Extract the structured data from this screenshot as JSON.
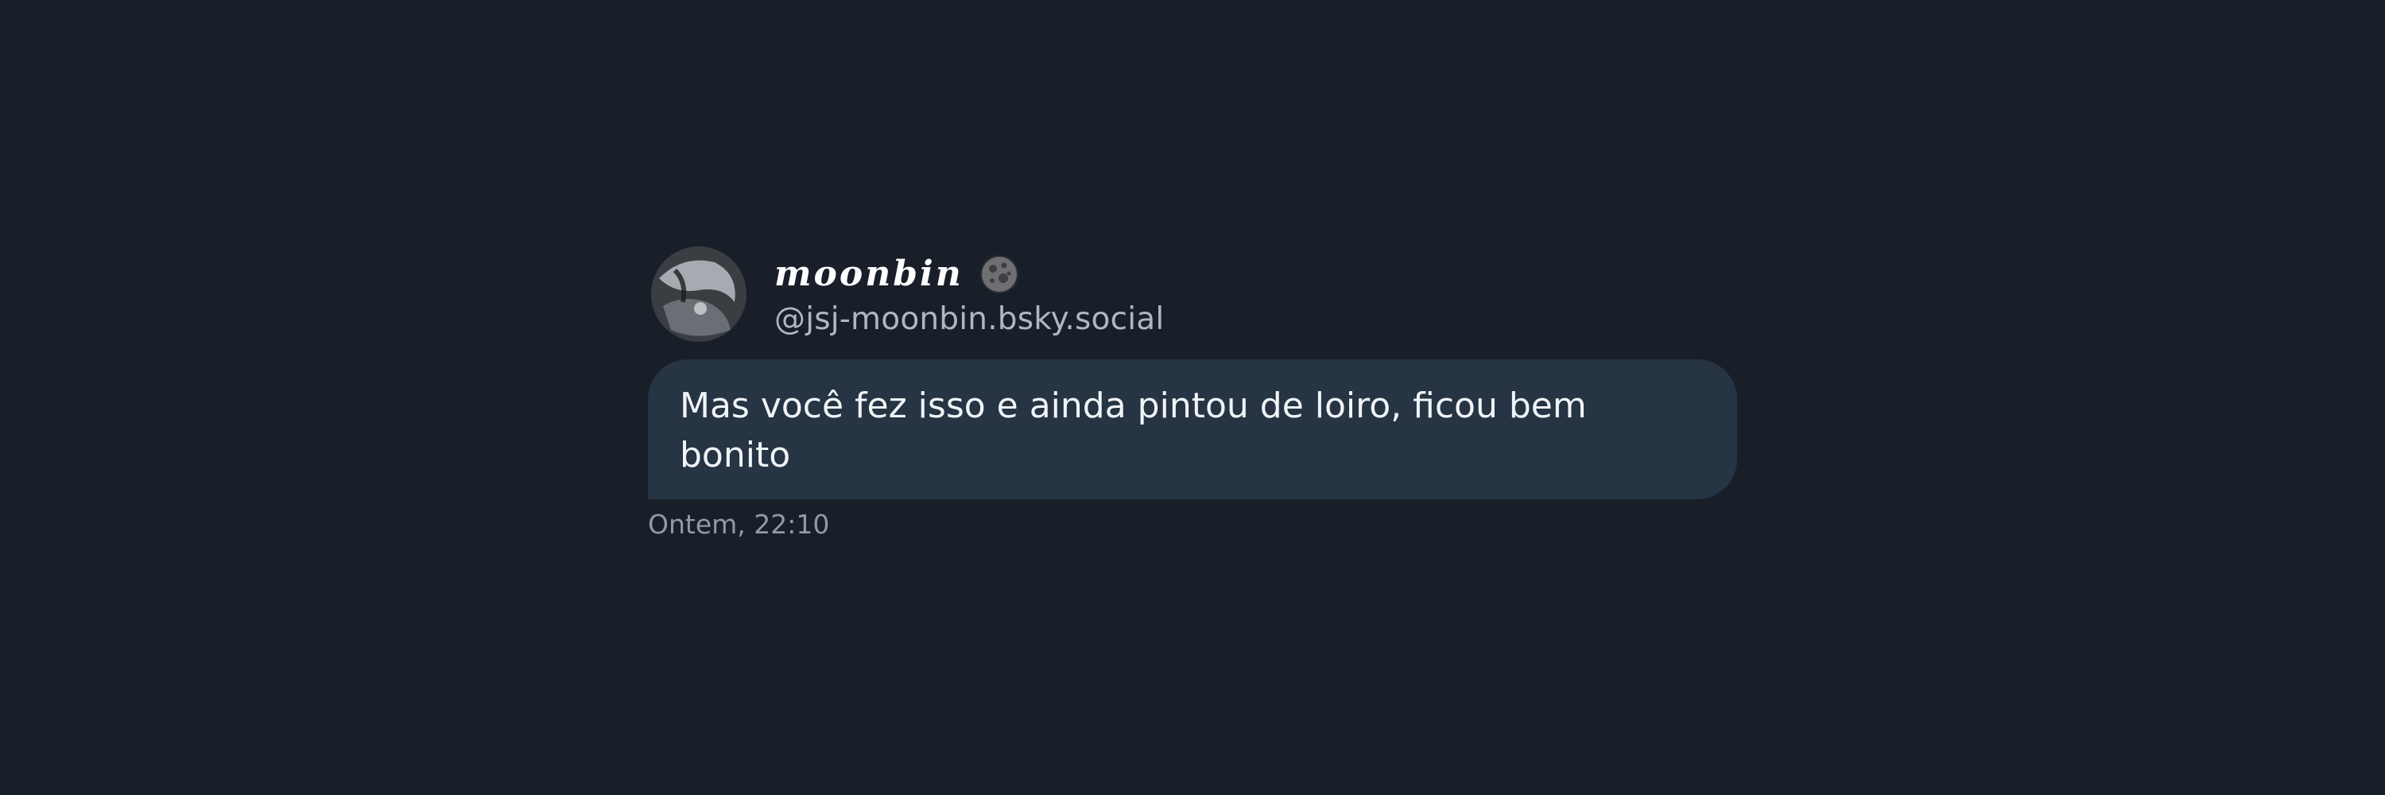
{
  "message": {
    "author": {
      "display_name": "moonbin",
      "handle": "@jsj-moonbin.bsky.social",
      "avatar_icon": "avatar-photo",
      "badge_icon": "moon-icon"
    },
    "text": "Mas você fez isso e ainda pintou de loiro, ficou bem bonito",
    "timestamp": "Ontem, 22:10"
  },
  "colors": {
    "background": "#181f29",
    "bubble": "#263444",
    "name": "#ffffff",
    "handle": "#aeb7c2",
    "timestamp": "#8f9aa6"
  }
}
